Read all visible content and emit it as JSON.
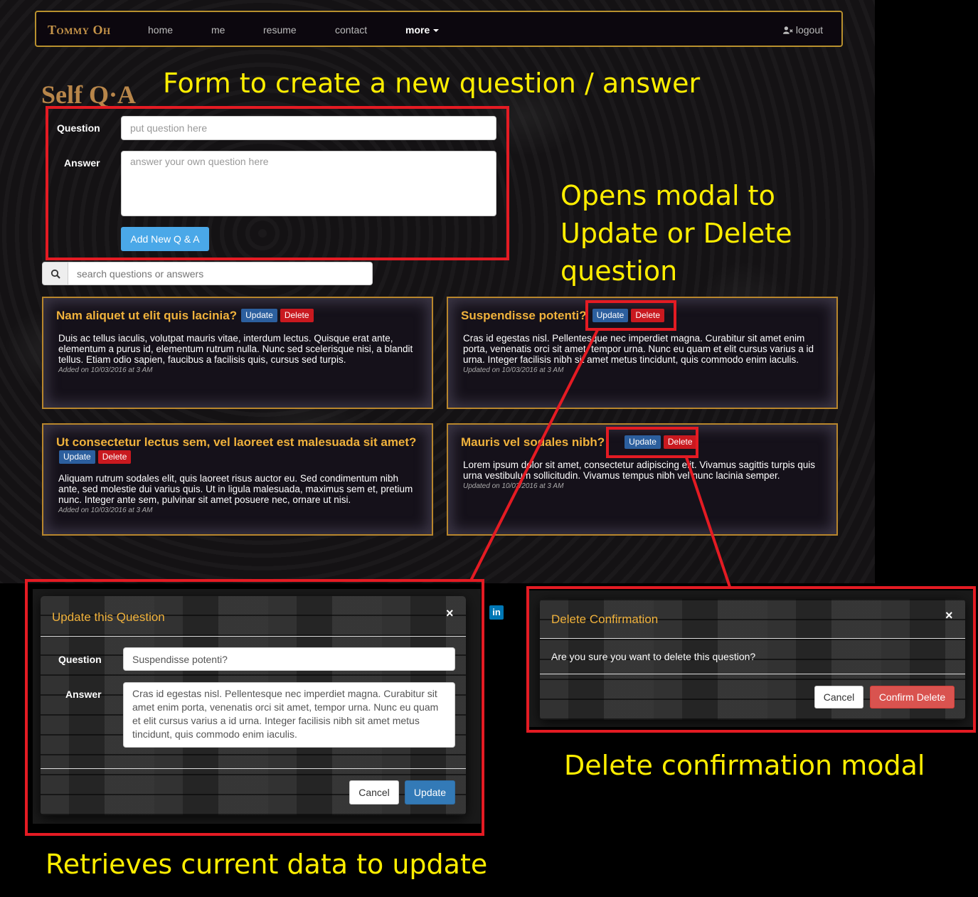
{
  "navbar": {
    "brand": "Tommy Oh",
    "links": [
      "home",
      "me",
      "resume",
      "contact"
    ],
    "more_label": "more",
    "logout_label": "logout"
  },
  "page": {
    "title": "Self Q·A"
  },
  "form": {
    "question_label": "Question",
    "question_placeholder": "put question here",
    "answer_label": "Answer",
    "answer_placeholder": "answer your own question here",
    "submit_label": "Add New Q & A"
  },
  "search": {
    "placeholder": "search questions or answers"
  },
  "cards": [
    {
      "title": "Nam aliquet ut elit quis lacinia?",
      "update_label": "Update",
      "delete_label": "Delete",
      "body": "Duis ac tellus iaculis, volutpat mauris vitae, interdum lectus. Quisque erat ante, elementum a purus id, elementum rutrum nulla. Nunc sed scelerisque nisi, a blandit tellus. Etiam odio sapien, faucibus a facilisis quis, cursus sed turpis.",
      "meta": "Added on 10/03/2016 at 3 AM"
    },
    {
      "title": "Suspendisse potenti?",
      "update_label": "Update",
      "delete_label": "Delete",
      "body": "Cras id egestas nisl. Pellentesque nec imperdiet magna. Curabitur sit amet enim porta, venenatis orci sit amet, tempor urna. Nunc eu quam et elit cursus varius a id urna. Integer facilisis nibh sit amet metus tincidunt, quis commodo enim iaculis.",
      "meta": "Updated on 10/03/2016 at 3 AM"
    },
    {
      "title": "Ut consectetur lectus sem, vel laoreet est malesuada sit amet?",
      "update_label": "Update",
      "delete_label": "Delete",
      "body": "Aliquam rutrum sodales elit, quis laoreet risus auctor eu. Sed condimentum nibh ante, sed molestie dui varius quis. Ut in ligula malesuada, maximus sem et, pretium nunc. Integer ante sem, pulvinar sit amet posuere nec, ornare ut nisi.",
      "meta": "Added on 10/03/2016 at 3 AM"
    },
    {
      "title": "Mauris vel sodales nibh?",
      "update_label": "Update",
      "delete_label": "Delete",
      "body": "Lorem ipsum dolor sit amet, consectetur adipiscing elit. Vivamus sagittis turpis quis urna vestibulum sollicitudin. Vivamus tempus nibh vel nunc lacinia semper.",
      "meta": "Updated on 10/03/2016 at 3 AM"
    }
  ],
  "update_modal": {
    "title": "Update this Question",
    "close_symbol": "×",
    "question_label": "Question",
    "question_value": "Suspendisse potenti?",
    "answer_label": "Answer",
    "answer_value": "Cras id egestas nisl. Pellentesque nec imperdiet magna. Curabitur sit amet enim porta, venenatis orci sit amet, tempor urna. Nunc eu quam et elit cursus varius a id urna. Integer facilisis nibh sit amet metus tincidunt, quis commodo enim iaculis.",
    "cancel_label": "Cancel",
    "update_label": "Update"
  },
  "delete_modal": {
    "title": "Delete Confirmation",
    "close_symbol": "×",
    "message": "Are you sure you want to delete this question?",
    "cancel_label": "Cancel",
    "confirm_label": "Confirm Delete"
  },
  "footer": {
    "linkedin_label": "in"
  },
  "annotations": {
    "form": "Form to create a new question / answer",
    "modal_open": "Opens modal to Update or Delete question",
    "delete": "Delete confirmation modal",
    "update": "Retrieves current data to update"
  },
  "colors": {
    "accent_gold": "#f0b23c",
    "annotation_yellow": "#ffee00",
    "highlight_red": "#e41b23",
    "update_blue": "#337ab7",
    "delete_red": "#d9534f"
  }
}
